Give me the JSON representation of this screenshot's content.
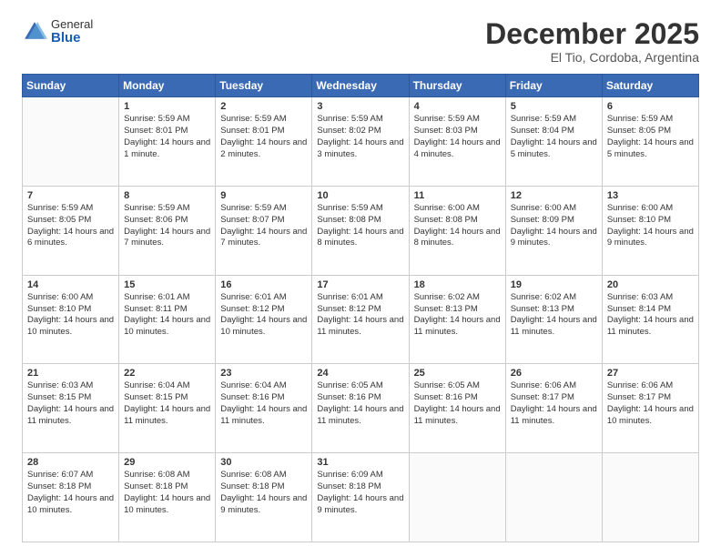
{
  "logo": {
    "general": "General",
    "blue": "Blue"
  },
  "title": "December 2025",
  "subtitle": "El Tio, Cordoba, Argentina",
  "days_of_week": [
    "Sunday",
    "Monday",
    "Tuesday",
    "Wednesday",
    "Thursday",
    "Friday",
    "Saturday"
  ],
  "weeks": [
    [
      {
        "day": "",
        "sunrise": "",
        "sunset": "",
        "daylight": ""
      },
      {
        "day": "1",
        "sunrise": "Sunrise: 5:59 AM",
        "sunset": "Sunset: 8:01 PM",
        "daylight": "Daylight: 14 hours and 1 minute."
      },
      {
        "day": "2",
        "sunrise": "Sunrise: 5:59 AM",
        "sunset": "Sunset: 8:01 PM",
        "daylight": "Daylight: 14 hours and 2 minutes."
      },
      {
        "day": "3",
        "sunrise": "Sunrise: 5:59 AM",
        "sunset": "Sunset: 8:02 PM",
        "daylight": "Daylight: 14 hours and 3 minutes."
      },
      {
        "day": "4",
        "sunrise": "Sunrise: 5:59 AM",
        "sunset": "Sunset: 8:03 PM",
        "daylight": "Daylight: 14 hours and 4 minutes."
      },
      {
        "day": "5",
        "sunrise": "Sunrise: 5:59 AM",
        "sunset": "Sunset: 8:04 PM",
        "daylight": "Daylight: 14 hours and 5 minutes."
      },
      {
        "day": "6",
        "sunrise": "Sunrise: 5:59 AM",
        "sunset": "Sunset: 8:05 PM",
        "daylight": "Daylight: 14 hours and 5 minutes."
      }
    ],
    [
      {
        "day": "7",
        "sunrise": "Sunrise: 5:59 AM",
        "sunset": "Sunset: 8:05 PM",
        "daylight": "Daylight: 14 hours and 6 minutes."
      },
      {
        "day": "8",
        "sunrise": "Sunrise: 5:59 AM",
        "sunset": "Sunset: 8:06 PM",
        "daylight": "Daylight: 14 hours and 7 minutes."
      },
      {
        "day": "9",
        "sunrise": "Sunrise: 5:59 AM",
        "sunset": "Sunset: 8:07 PM",
        "daylight": "Daylight: 14 hours and 7 minutes."
      },
      {
        "day": "10",
        "sunrise": "Sunrise: 5:59 AM",
        "sunset": "Sunset: 8:08 PM",
        "daylight": "Daylight: 14 hours and 8 minutes."
      },
      {
        "day": "11",
        "sunrise": "Sunrise: 6:00 AM",
        "sunset": "Sunset: 8:08 PM",
        "daylight": "Daylight: 14 hours and 8 minutes."
      },
      {
        "day": "12",
        "sunrise": "Sunrise: 6:00 AM",
        "sunset": "Sunset: 8:09 PM",
        "daylight": "Daylight: 14 hours and 9 minutes."
      },
      {
        "day": "13",
        "sunrise": "Sunrise: 6:00 AM",
        "sunset": "Sunset: 8:10 PM",
        "daylight": "Daylight: 14 hours and 9 minutes."
      }
    ],
    [
      {
        "day": "14",
        "sunrise": "Sunrise: 6:00 AM",
        "sunset": "Sunset: 8:10 PM",
        "daylight": "Daylight: 14 hours and 10 minutes."
      },
      {
        "day": "15",
        "sunrise": "Sunrise: 6:01 AM",
        "sunset": "Sunset: 8:11 PM",
        "daylight": "Daylight: 14 hours and 10 minutes."
      },
      {
        "day": "16",
        "sunrise": "Sunrise: 6:01 AM",
        "sunset": "Sunset: 8:12 PM",
        "daylight": "Daylight: 14 hours and 10 minutes."
      },
      {
        "day": "17",
        "sunrise": "Sunrise: 6:01 AM",
        "sunset": "Sunset: 8:12 PM",
        "daylight": "Daylight: 14 hours and 11 minutes."
      },
      {
        "day": "18",
        "sunrise": "Sunrise: 6:02 AM",
        "sunset": "Sunset: 8:13 PM",
        "daylight": "Daylight: 14 hours and 11 minutes."
      },
      {
        "day": "19",
        "sunrise": "Sunrise: 6:02 AM",
        "sunset": "Sunset: 8:13 PM",
        "daylight": "Daylight: 14 hours and 11 minutes."
      },
      {
        "day": "20",
        "sunrise": "Sunrise: 6:03 AM",
        "sunset": "Sunset: 8:14 PM",
        "daylight": "Daylight: 14 hours and 11 minutes."
      }
    ],
    [
      {
        "day": "21",
        "sunrise": "Sunrise: 6:03 AM",
        "sunset": "Sunset: 8:15 PM",
        "daylight": "Daylight: 14 hours and 11 minutes."
      },
      {
        "day": "22",
        "sunrise": "Sunrise: 6:04 AM",
        "sunset": "Sunset: 8:15 PM",
        "daylight": "Daylight: 14 hours and 11 minutes."
      },
      {
        "day": "23",
        "sunrise": "Sunrise: 6:04 AM",
        "sunset": "Sunset: 8:16 PM",
        "daylight": "Daylight: 14 hours and 11 minutes."
      },
      {
        "day": "24",
        "sunrise": "Sunrise: 6:05 AM",
        "sunset": "Sunset: 8:16 PM",
        "daylight": "Daylight: 14 hours and 11 minutes."
      },
      {
        "day": "25",
        "sunrise": "Sunrise: 6:05 AM",
        "sunset": "Sunset: 8:16 PM",
        "daylight": "Daylight: 14 hours and 11 minutes."
      },
      {
        "day": "26",
        "sunrise": "Sunrise: 6:06 AM",
        "sunset": "Sunset: 8:17 PM",
        "daylight": "Daylight: 14 hours and 11 minutes."
      },
      {
        "day": "27",
        "sunrise": "Sunrise: 6:06 AM",
        "sunset": "Sunset: 8:17 PM",
        "daylight": "Daylight: 14 hours and 10 minutes."
      }
    ],
    [
      {
        "day": "28",
        "sunrise": "Sunrise: 6:07 AM",
        "sunset": "Sunset: 8:18 PM",
        "daylight": "Daylight: 14 hours and 10 minutes."
      },
      {
        "day": "29",
        "sunrise": "Sunrise: 6:08 AM",
        "sunset": "Sunset: 8:18 PM",
        "daylight": "Daylight: 14 hours and 10 minutes."
      },
      {
        "day": "30",
        "sunrise": "Sunrise: 6:08 AM",
        "sunset": "Sunset: 8:18 PM",
        "daylight": "Daylight: 14 hours and 9 minutes."
      },
      {
        "day": "31",
        "sunrise": "Sunrise: 6:09 AM",
        "sunset": "Sunset: 8:18 PM",
        "daylight": "Daylight: 14 hours and 9 minutes."
      },
      {
        "day": "",
        "sunrise": "",
        "sunset": "",
        "daylight": ""
      },
      {
        "day": "",
        "sunrise": "",
        "sunset": "",
        "daylight": ""
      },
      {
        "day": "",
        "sunrise": "",
        "sunset": "",
        "daylight": ""
      }
    ]
  ]
}
